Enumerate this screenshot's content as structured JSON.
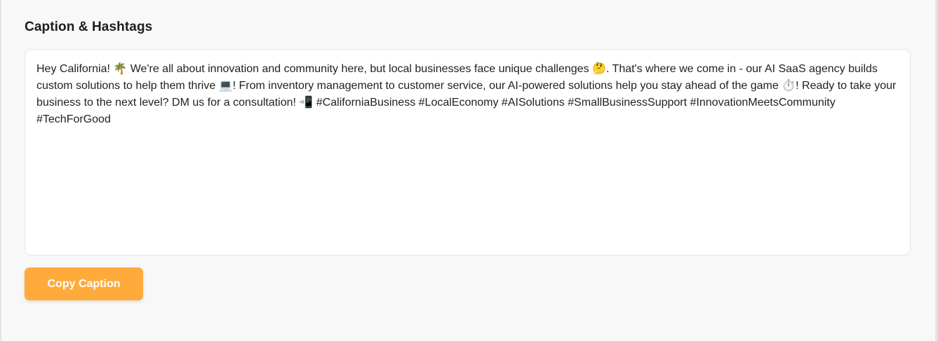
{
  "section": {
    "title": "Caption & Hashtags"
  },
  "caption": {
    "text": "Hey California! 🌴 We're all about innovation and community here, but local businesses face unique challenges 🤔. That's where we come in - our AI SaaS agency builds custom solutions to help them thrive 💻! From inventory management to customer service, our AI-powered solutions help you stay ahead of the game ⏱️! Ready to take your business to the next level? DM us for a consultation! 📲 #CaliforniaBusiness #LocalEconomy #AISolutions #SmallBusinessSupport #InnovationMeetsCommunity #TechForGood"
  },
  "actions": {
    "copy_label": "Copy Caption"
  },
  "colors": {
    "accent": "#ffab3b",
    "border": "#e6e6e6",
    "text": "#222222"
  }
}
